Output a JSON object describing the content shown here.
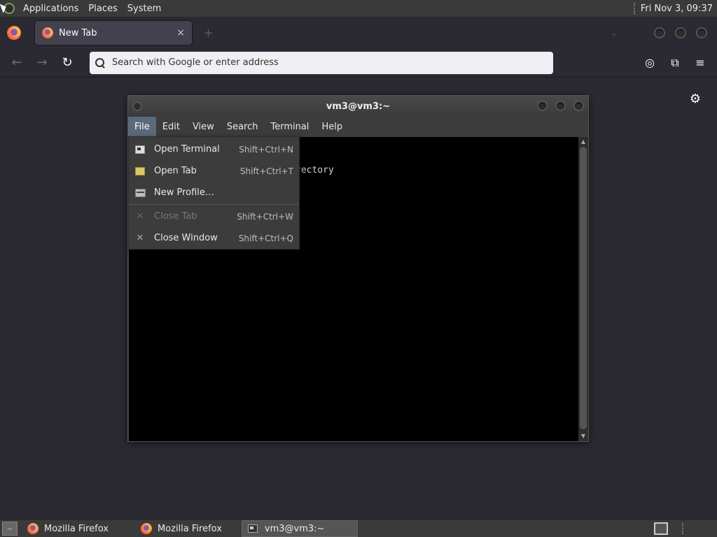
{
  "top_panel": {
    "menus": [
      "Applications",
      "Places",
      "System"
    ],
    "clock": "Fri Nov 3, 09:37"
  },
  "firefox": {
    "tab": {
      "title": "New Tab",
      "close": "×"
    },
    "new_tab": "+",
    "url_placeholder": "Search with Google or enter address",
    "nav": {
      "back": "←",
      "forward": "→",
      "reload": "↻"
    },
    "tools": {
      "pocket": "◎",
      "extensions": "⧉",
      "menu": "≡"
    },
    "settings": "⚙"
  },
  "terminal": {
    "title": "vm3@vm3:~",
    "menus": [
      "File",
      "Edit",
      "View",
      "Search",
      "Terminal",
      "Help"
    ],
    "active_menu": "File",
    "visible_text": "rectory"
  },
  "file_menu": {
    "items": [
      {
        "label": "Open Terminal",
        "accel": "Shift+Ctrl+N",
        "icon": "terminal-icon",
        "enabled": true
      },
      {
        "label": "Open Tab",
        "accel": "Shift+Ctrl+T",
        "icon": "tab-icon",
        "enabled": true
      },
      {
        "label": "New Profile…",
        "accel": "",
        "icon": "profile-icon",
        "enabled": true
      },
      {
        "label": "Close Tab",
        "accel": "Shift+Ctrl+W",
        "icon": "close-icon",
        "enabled": false
      },
      {
        "label": "Close Window",
        "accel": "Shift+Ctrl+Q",
        "icon": "close-icon",
        "enabled": true
      }
    ]
  },
  "taskbar": {
    "tasks": [
      "Mozilla Firefox",
      "Mozilla Firefox",
      "vm3@vm3:~"
    ]
  },
  "colors": {
    "menu_highlight": "#5a6a7a",
    "firefox_bg": "#2b2a33",
    "panel_bg": "#3a3a3a"
  }
}
